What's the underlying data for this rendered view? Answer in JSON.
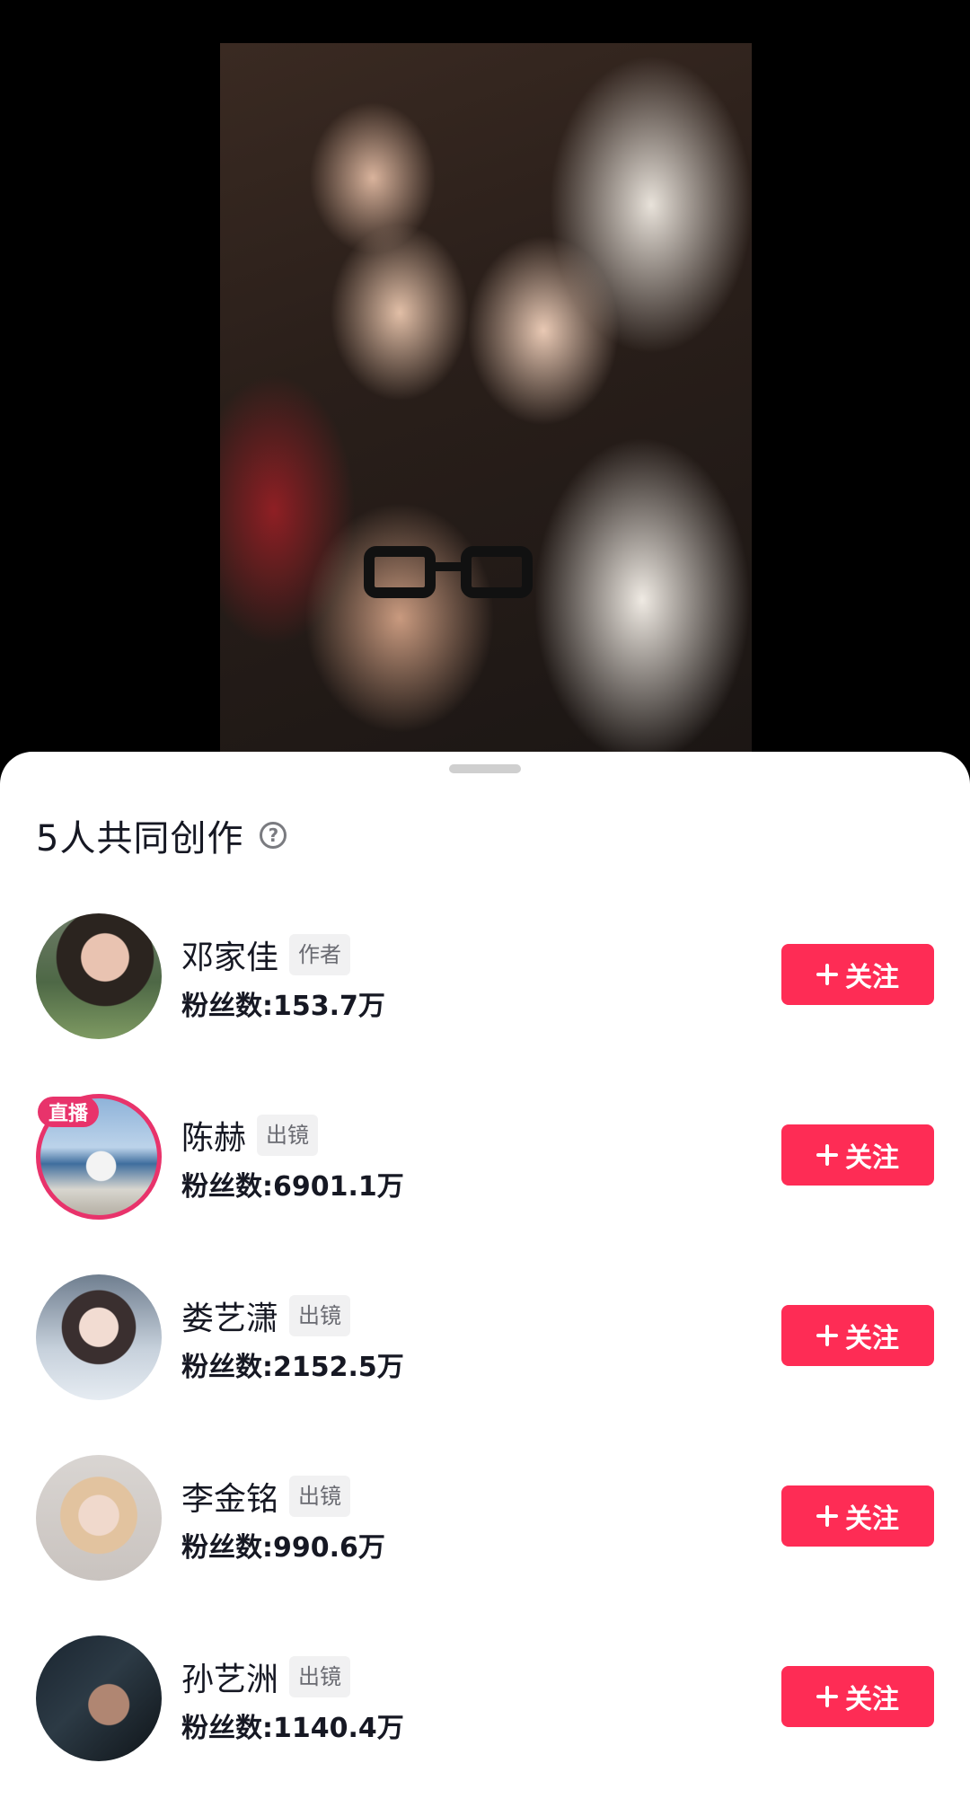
{
  "sheet": {
    "title": "5人共同创作",
    "help_icon": "question-circle-icon"
  },
  "creators": [
    {
      "name": "邓家佳",
      "role": "作者",
      "fans": "粉丝数:153.7万",
      "follow_label": "关注",
      "live": false
    },
    {
      "name": "陈赫",
      "role": "出镜",
      "fans": "粉丝数:6901.1万",
      "follow_label": "关注",
      "live": true,
      "live_label": "直播"
    },
    {
      "name": "娄艺潇",
      "role": "出镜",
      "fans": "粉丝数:2152.5万",
      "follow_label": "关注",
      "live": false
    },
    {
      "name": "李金铭",
      "role": "出镜",
      "fans": "粉丝数:990.6万",
      "follow_label": "关注",
      "live": false
    },
    {
      "name": "孙艺洲",
      "role": "出镜",
      "fans": "粉丝数:1140.4万",
      "follow_label": "关注",
      "live": false
    }
  ],
  "colors": {
    "follow_button": "#fe2c55",
    "live_ring": "#e8336b"
  }
}
